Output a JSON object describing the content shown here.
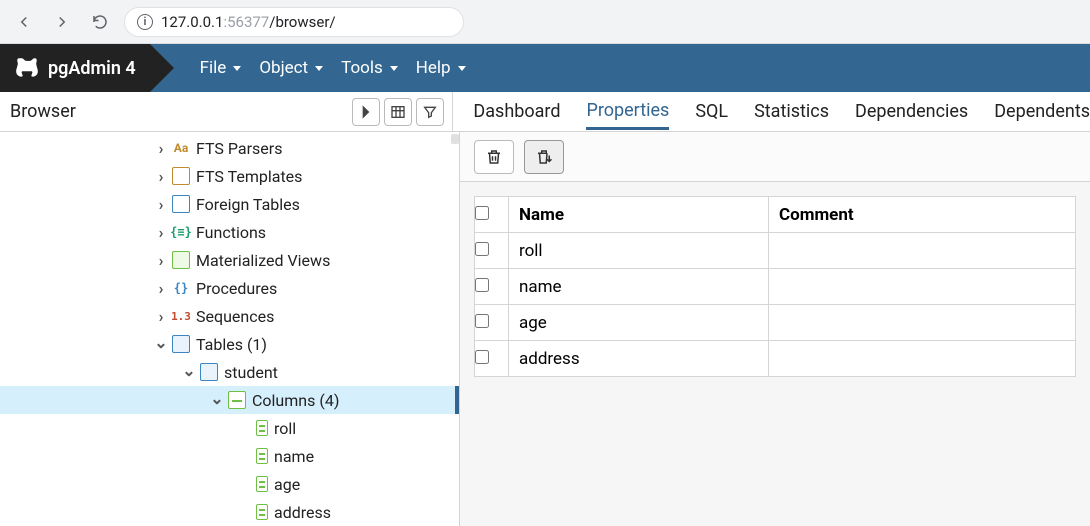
{
  "chrome": {
    "url_host": "127.0.0.1",
    "url_port": ":56377",
    "url_path": "/browser/"
  },
  "brand": {
    "title": "pgAdmin 4"
  },
  "menus": {
    "file": "File",
    "object": "Object",
    "tools": "Tools",
    "help": "Help"
  },
  "panel": {
    "browser_label": "Browser",
    "tabs": {
      "dashboard": "Dashboard",
      "properties": "Properties",
      "sql": "SQL",
      "statistics": "Statistics",
      "dependencies": "Dependencies",
      "dependents": "Dependents"
    }
  },
  "tree": {
    "fts_parsers": "FTS Parsers",
    "fts_templates": "FTS Templates",
    "foreign_tables": "Foreign Tables",
    "functions": "Functions",
    "materialized_views": "Materialized Views",
    "procedures": "Procedures",
    "sequences": "Sequences",
    "tables": "Tables (1)",
    "student": "student",
    "columns": "Columns (4)",
    "cols": [
      "roll",
      "name",
      "age",
      "address"
    ]
  },
  "grid": {
    "headers": {
      "name": "Name",
      "comment": "Comment"
    },
    "rows": [
      {
        "name": "roll",
        "comment": ""
      },
      {
        "name": "name",
        "comment": ""
      },
      {
        "name": "age",
        "comment": ""
      },
      {
        "name": "address",
        "comment": ""
      }
    ]
  }
}
